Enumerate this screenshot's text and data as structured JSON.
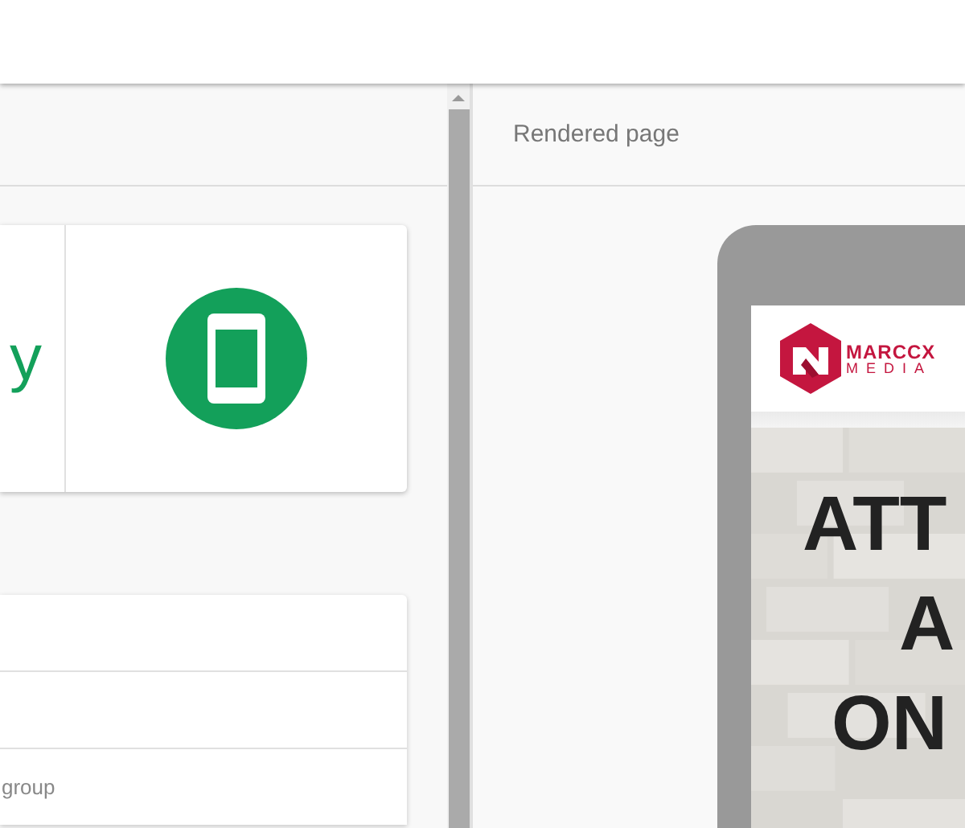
{
  "left_panel": {
    "summary_card": {
      "result_fragment": "y"
    },
    "list_card": {
      "rows": [
        "",
        "",
        "group"
      ]
    }
  },
  "right_panel": {
    "title": "Rendered page",
    "preview": {
      "logo": {
        "line_1": "MARCCX",
        "line_2": "MEDIA"
      },
      "headline": [
        "ATT",
        "A",
        "ON"
      ]
    }
  }
}
